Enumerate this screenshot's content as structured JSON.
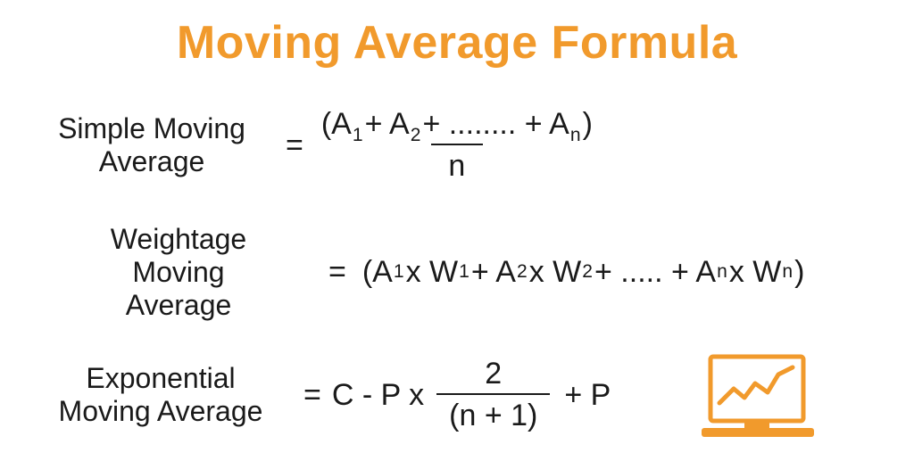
{
  "title": "Moving Average Formula",
  "colors": {
    "accent": "#f19a2c",
    "ink": "#1a1a1a"
  },
  "formulas": {
    "sma": {
      "label_line1": "Simple Moving",
      "label_line2": "Average",
      "equals": "=",
      "numerator": "(A₁+ A₂+ ........ + Aₙ)",
      "denominator": "n"
    },
    "wma": {
      "label_line1": "Weightage",
      "label_line2": "Moving",
      "label_line3": "Average",
      "equals": "=",
      "expression": "(A₁ x W₁ + A₂ x W₂ + ..... + Aₙ x Wₙ)"
    },
    "ema": {
      "label_line1": "Exponential",
      "label_line2": "Moving Average",
      "equals": "=",
      "lead": "C - P x",
      "numerator": "2",
      "denominator": "(n + 1)",
      "tail": "+ P"
    }
  },
  "icon": {
    "name": "chart-laptop-icon"
  }
}
